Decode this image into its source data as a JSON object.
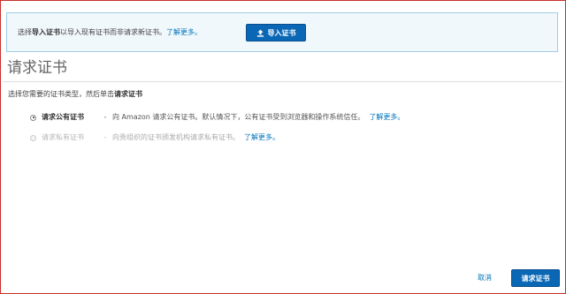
{
  "info_banner": {
    "text_prefix": "选择",
    "text_bold": "导入证书",
    "text_suffix": "以导入现有证书而非请求新证书。",
    "learn_more": "了解更多。",
    "import_button_label": "导入证书",
    "import_button_icon": "upload-icon"
  },
  "page": {
    "title": "请求证书"
  },
  "instruction": {
    "text": "选择您需要的证书类型，然后单击",
    "bold": "请求证书"
  },
  "options": [
    {
      "label": "请求公有证书",
      "separator": "-",
      "description": "向 Amazon 请求公有证书。默认情况下，公有证书受到浏览器和操作系统信任。",
      "learn_more": "了解更多。",
      "selected": true,
      "enabled": true
    },
    {
      "label": "请求私有证书",
      "separator": "-",
      "description": "向贵组织的证书颁发机构请求私有证书。",
      "learn_more": "了解更多。",
      "selected": false,
      "enabled": false
    }
  ],
  "footer": {
    "cancel_label": "取消",
    "submit_label": "请求证书"
  },
  "colors": {
    "primary_button": "#0a67b5",
    "link": "#0073bb",
    "info_background": "#f1f8fc",
    "info_border": "#9fcde3",
    "frame_border": "#c9302c"
  }
}
